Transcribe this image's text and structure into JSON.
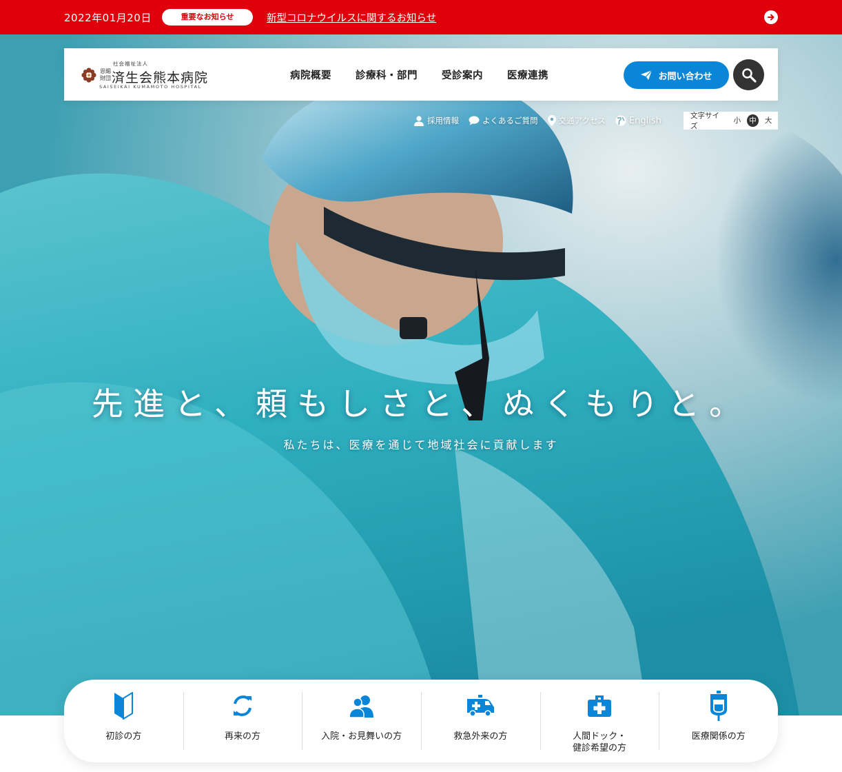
{
  "alert": {
    "date": "2022年01月20日",
    "badge": "重要なお知らせ",
    "link": "新型コロナウイルスに関するお知らせ"
  },
  "logo": {
    "small": "社会福祉法人",
    "pre": "恩賜財団",
    "name": "済生会熊本病院",
    "en": "SAISEIKAI KUMAMOTO HOSPITAL"
  },
  "gnav": [
    {
      "label": "病院概要"
    },
    {
      "label": "診療科・部門"
    },
    {
      "label": "受診案内"
    },
    {
      "label": "医療連携"
    }
  ],
  "header": {
    "contact_label": "お問い合わせ"
  },
  "util": {
    "recruit": "採用情報",
    "faq": "よくあるご質問",
    "access": "交通アクセス",
    "english": "English",
    "fontsize_label": "文字サイズ",
    "fs_small": "小",
    "fs_medium": "中",
    "fs_large": "大"
  },
  "hero": {
    "title": "先進と、頼もしさと、ぬくもりと。",
    "subtitle": "私たちは、医療を通じて地域社会に貢献します"
  },
  "quick": [
    {
      "label": "初診の方",
      "icon": "beginner-mark-icon"
    },
    {
      "label": "再来の方",
      "icon": "refresh-icon"
    },
    {
      "label": "入院・お見舞いの方",
      "icon": "people-icon"
    },
    {
      "label": "救急外来の方",
      "icon": "ambulance-icon"
    },
    {
      "label": "人間ドック・\n健診希望の方",
      "icon": "medical-kit-icon"
    },
    {
      "label": "医療関係の方",
      "icon": "iv-drip-icon"
    }
  ],
  "colors": {
    "alert_red": "#e0000b",
    "accent_blue": "#0a86d9",
    "dark": "#333333"
  }
}
